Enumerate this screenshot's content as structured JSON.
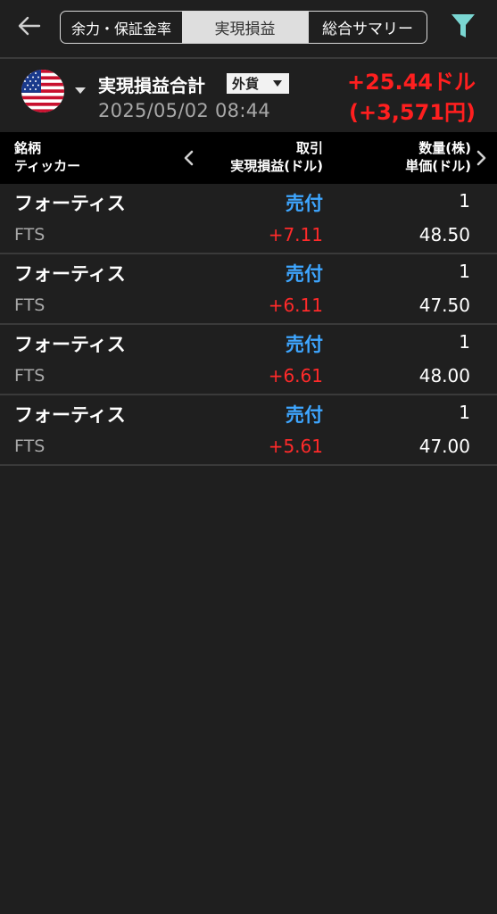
{
  "header": {
    "back_icon": "arrow-left-icon",
    "tabs": [
      {
        "label": "余力・保証金率",
        "active": false
      },
      {
        "label": "実現損益",
        "active": true
      },
      {
        "label": "総合サマリー",
        "active": false
      }
    ],
    "filter_icon": "filter-icon",
    "filter_color": "#7ad6d2"
  },
  "summary": {
    "flag_icon": "us-flag-icon",
    "title": "実現損益合計",
    "currency": "外貨",
    "datetime": "2025/05/02  08:44",
    "total_usd": "+25.44ドル",
    "total_jpy": "(+3,571円)"
  },
  "columns": {
    "left_line1": "銘柄",
    "left_line2": "ティッカー",
    "mid_line1": "取引",
    "mid_line2": "実現損益(ドル)",
    "right_line1": "数量(株)",
    "right_line2": "単価(ドル)"
  },
  "rows": [
    {
      "name": "フォーティス",
      "ticker": "FTS",
      "trade": "売付",
      "pl": "+7.11",
      "qty": "1",
      "price": "48.50"
    },
    {
      "name": "フォーティス",
      "ticker": "FTS",
      "trade": "売付",
      "pl": "+6.11",
      "qty": "1",
      "price": "47.50"
    },
    {
      "name": "フォーティス",
      "ticker": "FTS",
      "trade": "売付",
      "pl": "+6.61",
      "qty": "1",
      "price": "48.00"
    },
    {
      "name": "フォーティス",
      "ticker": "FTS",
      "trade": "売付",
      "pl": "+5.61",
      "qty": "1",
      "price": "47.00"
    }
  ],
  "colors": {
    "profit": "#ff2a2a",
    "trade_sell": "#3ea6ff",
    "background": "#1f1f1f"
  }
}
